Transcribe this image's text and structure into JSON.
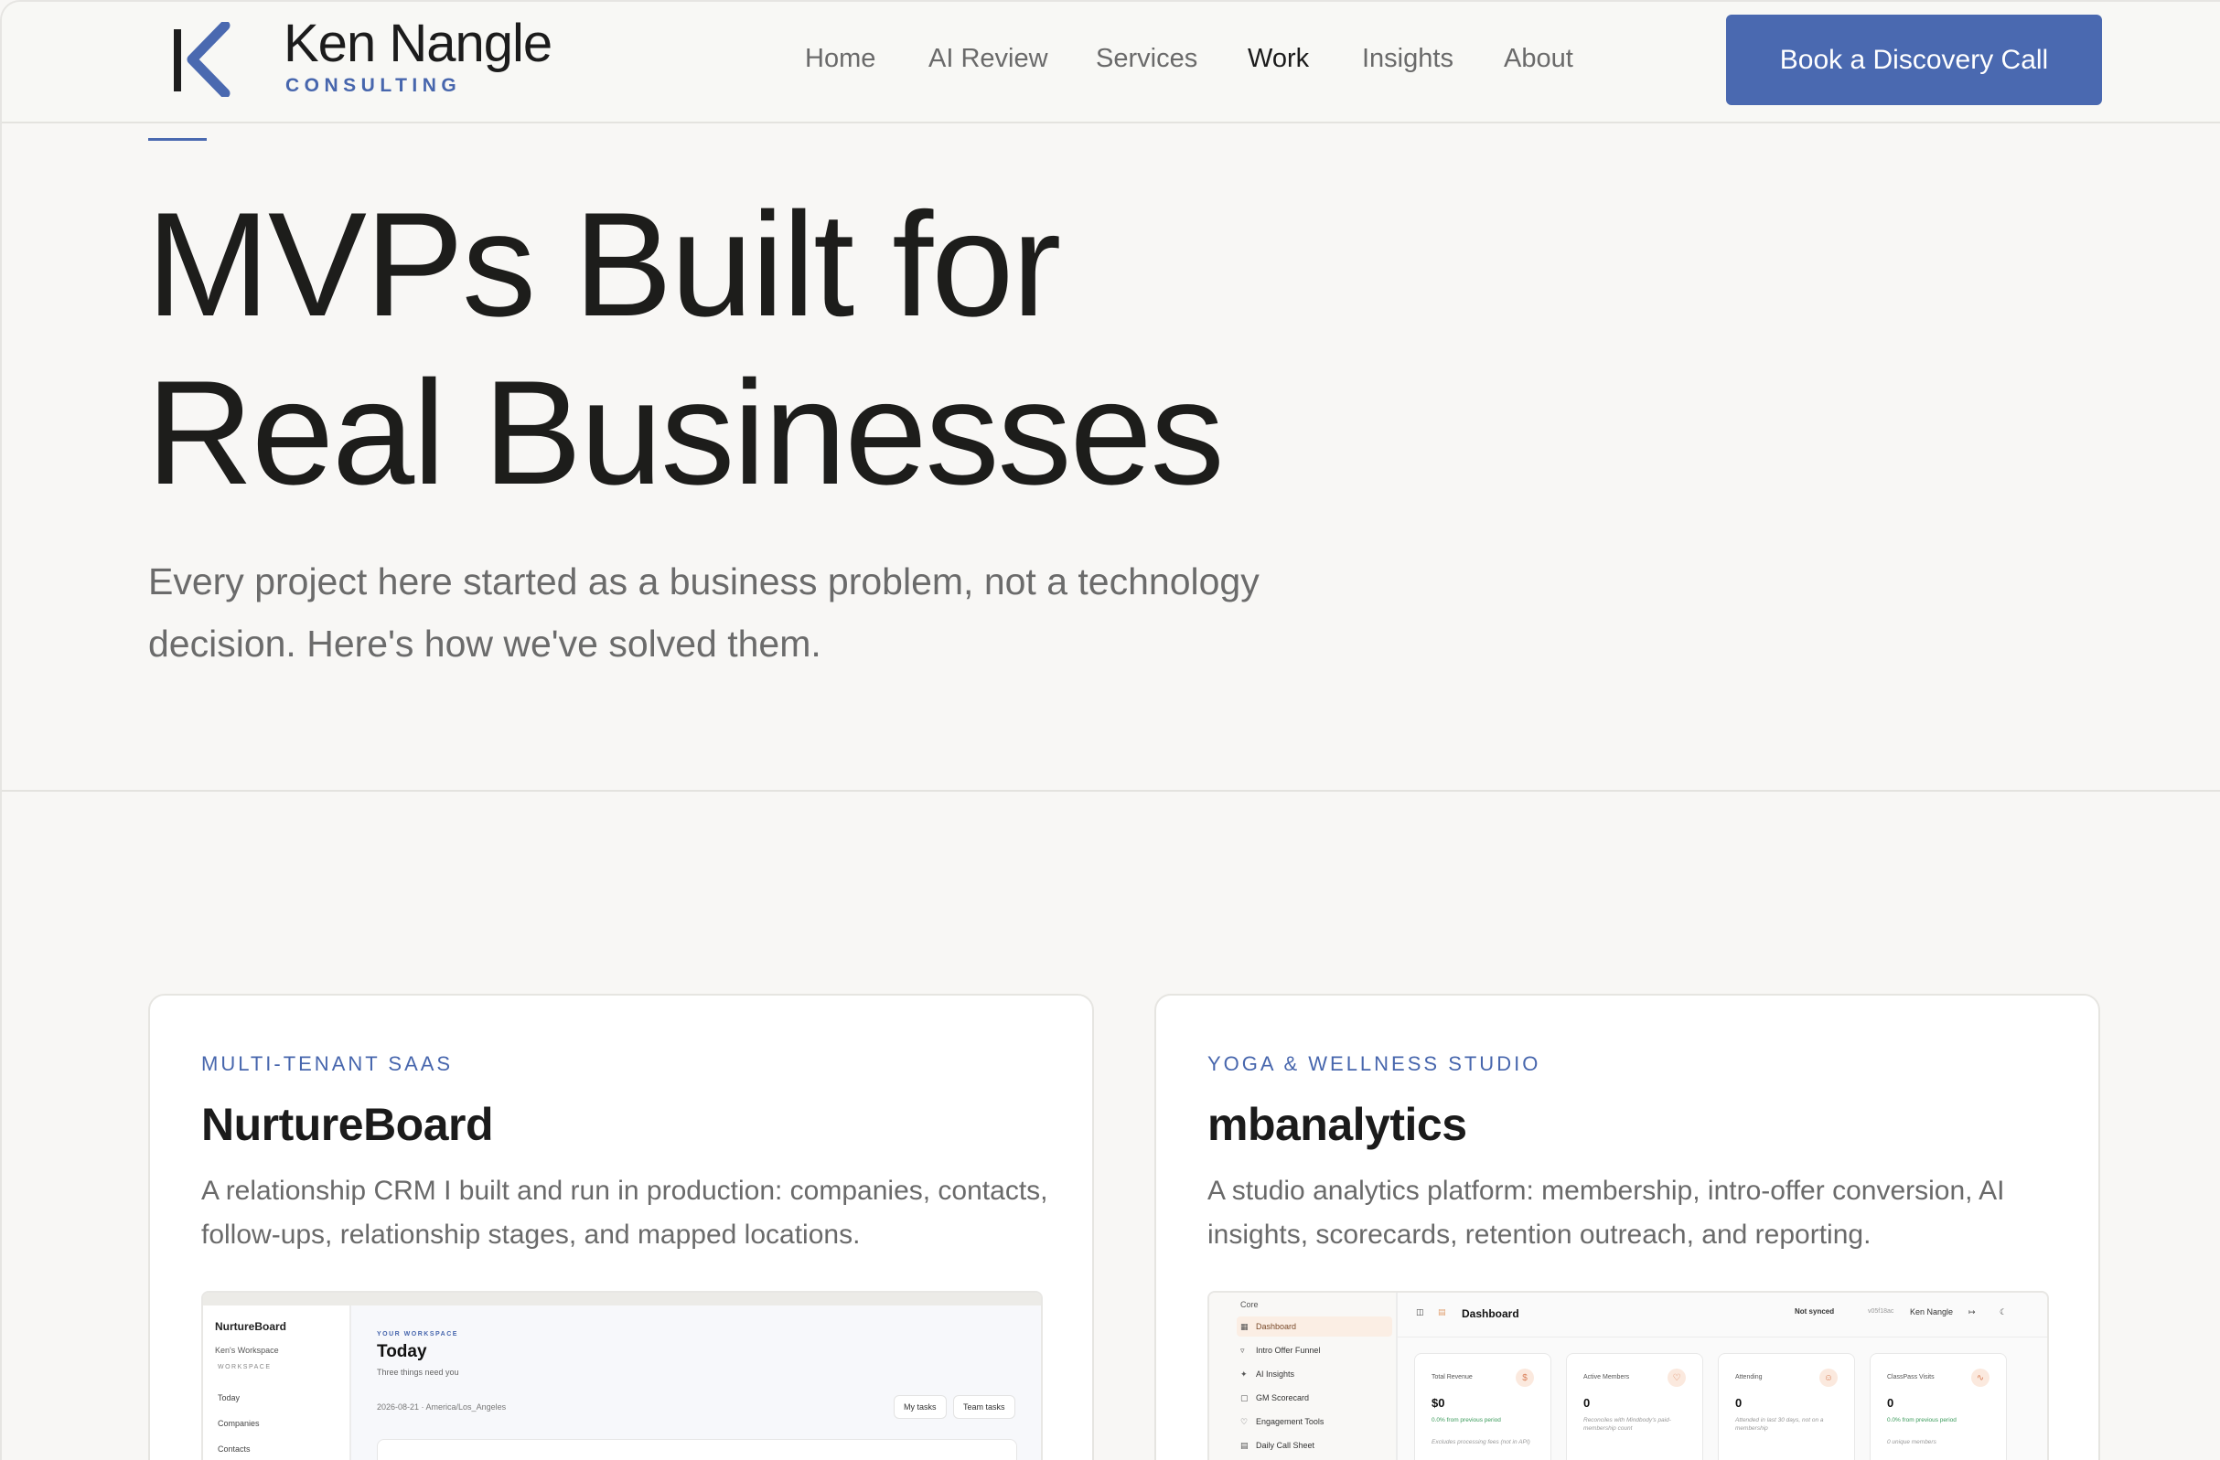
{
  "header": {
    "brand_name": "Ken Nangle",
    "brand_sub": "CONSULTING",
    "nav": [
      {
        "label": "Home"
      },
      {
        "label": "AI Review"
      },
      {
        "label": "Services"
      },
      {
        "label": "Work",
        "active": true
      },
      {
        "label": "Insights"
      },
      {
        "label": "About"
      }
    ],
    "cta_label": "Book a Discovery Call"
  },
  "hero": {
    "title_line1": "MVPs Built for",
    "title_line2": "Real Businesses",
    "subtitle": "Every project here started as a business problem, not a technology decision. Here's how we've solved them."
  },
  "cards": [
    {
      "category": "MULTI-TENANT SAAS",
      "title": "NurtureBoard",
      "description": "A relationship CRM I built and run in production: companies, contacts, follow-ups, relationship stages, and mapped locations.",
      "preview": {
        "app_name": "NurtureBoard",
        "workspace": "Ken's Workspace",
        "section": "WORKSPACE",
        "nav": [
          "Today",
          "Companies",
          "Contacts"
        ],
        "kicker": "YOUR WORKSPACE",
        "heading": "Today",
        "sub": "Three things need you",
        "date_line": "2026-08-21 · America/Los_Angeles",
        "buttons": [
          "My tasks",
          "Team tasks"
        ]
      }
    },
    {
      "category": "YOGA & WELLNESS STUDIO",
      "title": "mbanalytics",
      "description": "A studio analytics platform: membership, intro-offer conversion, AI insights, scorecards, retention outreach, and reporting.",
      "preview": {
        "section": "Core",
        "nav": [
          "Dashboard",
          "Intro Offer Funnel",
          "AI Insights",
          "GM Scorecard",
          "Engagement Tools",
          "Daily Call Sheet"
        ],
        "title": "Dashboard",
        "sync": "Not synced",
        "version": "v05f18ac",
        "user": "Ken Nangle",
        "stats": [
          {
            "label": "Total Revenue",
            "value": "$0",
            "note": "0.0% from previous period",
            "note2": "Excludes processing fees (not in API)",
            "badge": "$"
          },
          {
            "label": "Active Members",
            "value": "0",
            "note": "Reconciles with Mindbody's paid-membership count",
            "badge": "♡"
          },
          {
            "label": "Attending",
            "value": "0",
            "note": "Attended in last 30 days, not on a membership",
            "badge": "☺"
          },
          {
            "label": "ClassPass Visits",
            "value": "0",
            "note": "0.0% from previous period",
            "note2": "0 unique members",
            "badge": "∿"
          }
        ]
      }
    }
  ]
}
